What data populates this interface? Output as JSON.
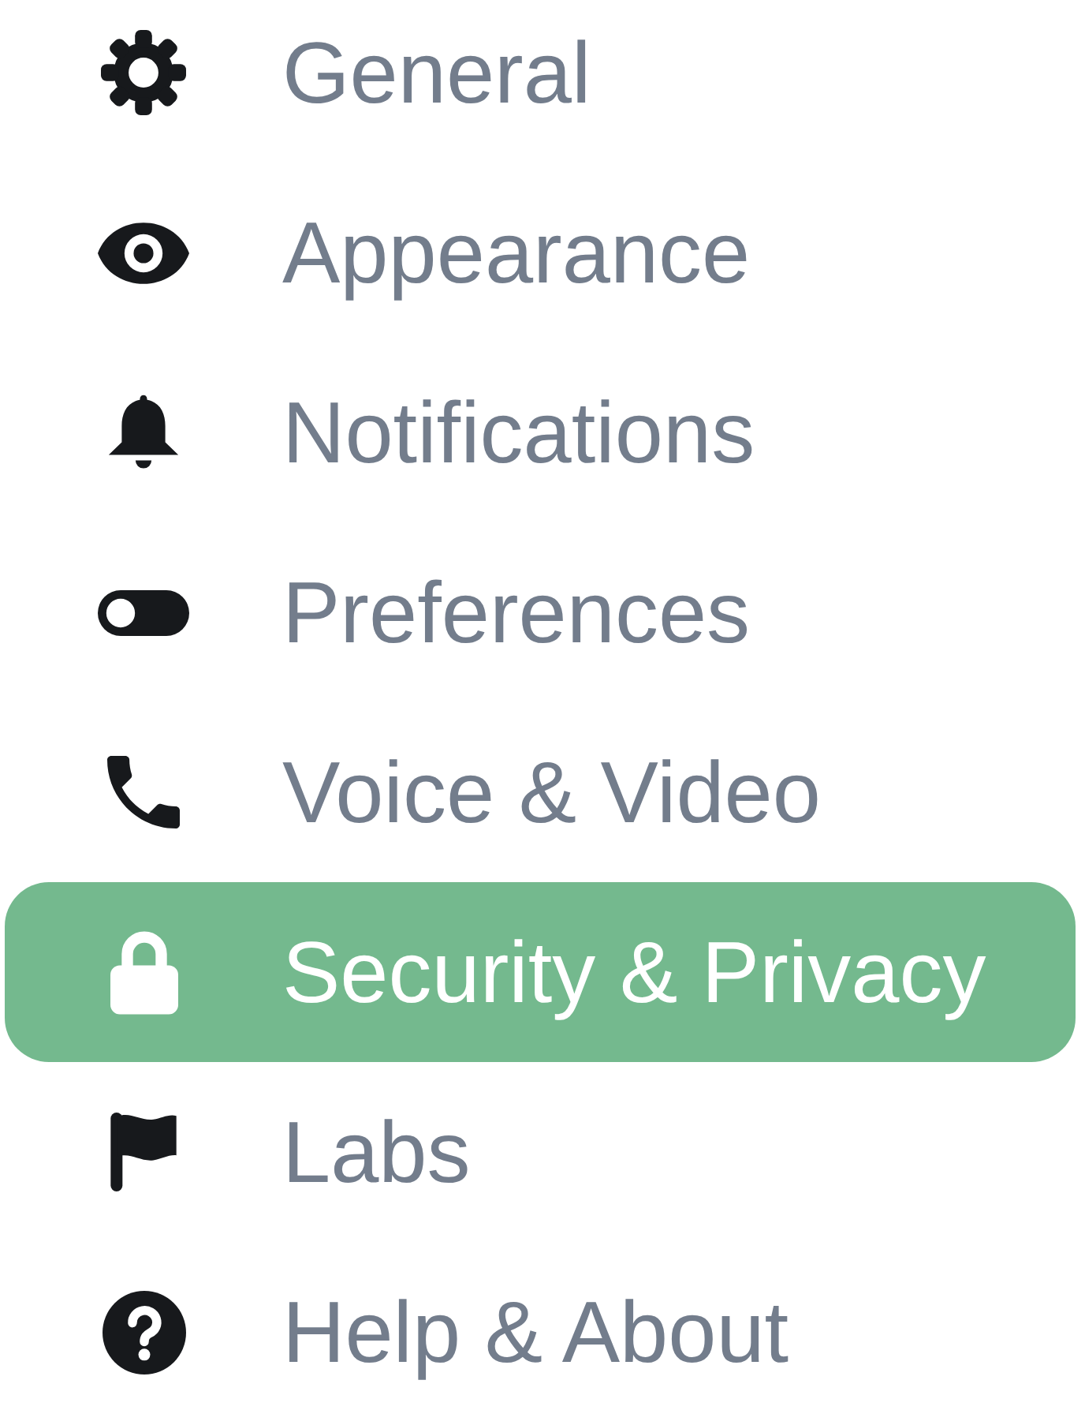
{
  "menu": {
    "items": [
      {
        "label": "General",
        "kind": "gear",
        "selected": false
      },
      {
        "label": "Appearance",
        "kind": "eye",
        "selected": false
      },
      {
        "label": "Notifications",
        "kind": "bell",
        "selected": false
      },
      {
        "label": "Preferences",
        "kind": "toggle",
        "selected": false
      },
      {
        "label": "Voice & Video",
        "kind": "phone",
        "selected": false
      },
      {
        "label": "Security & Privacy",
        "kind": "lock",
        "selected": true
      },
      {
        "label": "Labs",
        "kind": "flag",
        "selected": false
      },
      {
        "label": "Help & About",
        "kind": "help",
        "selected": false
      }
    ]
  }
}
